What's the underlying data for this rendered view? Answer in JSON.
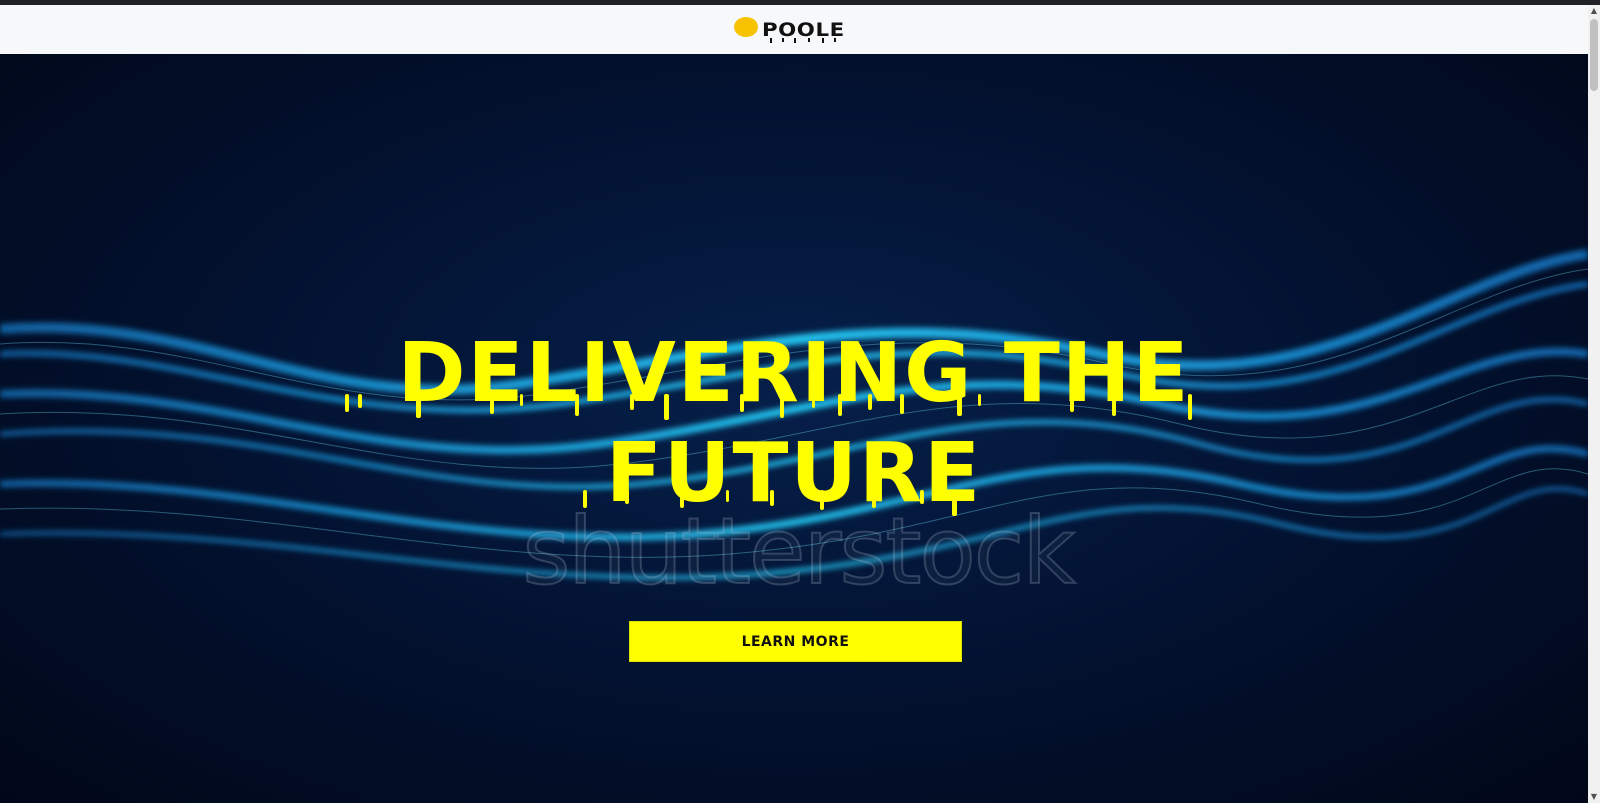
{
  "header": {
    "logo_text": "POOLE"
  },
  "hero": {
    "headline_line1": "DELIVERING THE",
    "headline_line2": "FUTURE",
    "watermark": "shutterstock",
    "cta_label": "LEARN MORE"
  },
  "colors": {
    "accent": "#ffff00",
    "logo_dot": "#f7c200",
    "hero_bg": "#020b25",
    "header_bg": "#f7f8fa"
  },
  "scrollbar": {
    "up_icon": "▲",
    "down_icon": "▼"
  }
}
